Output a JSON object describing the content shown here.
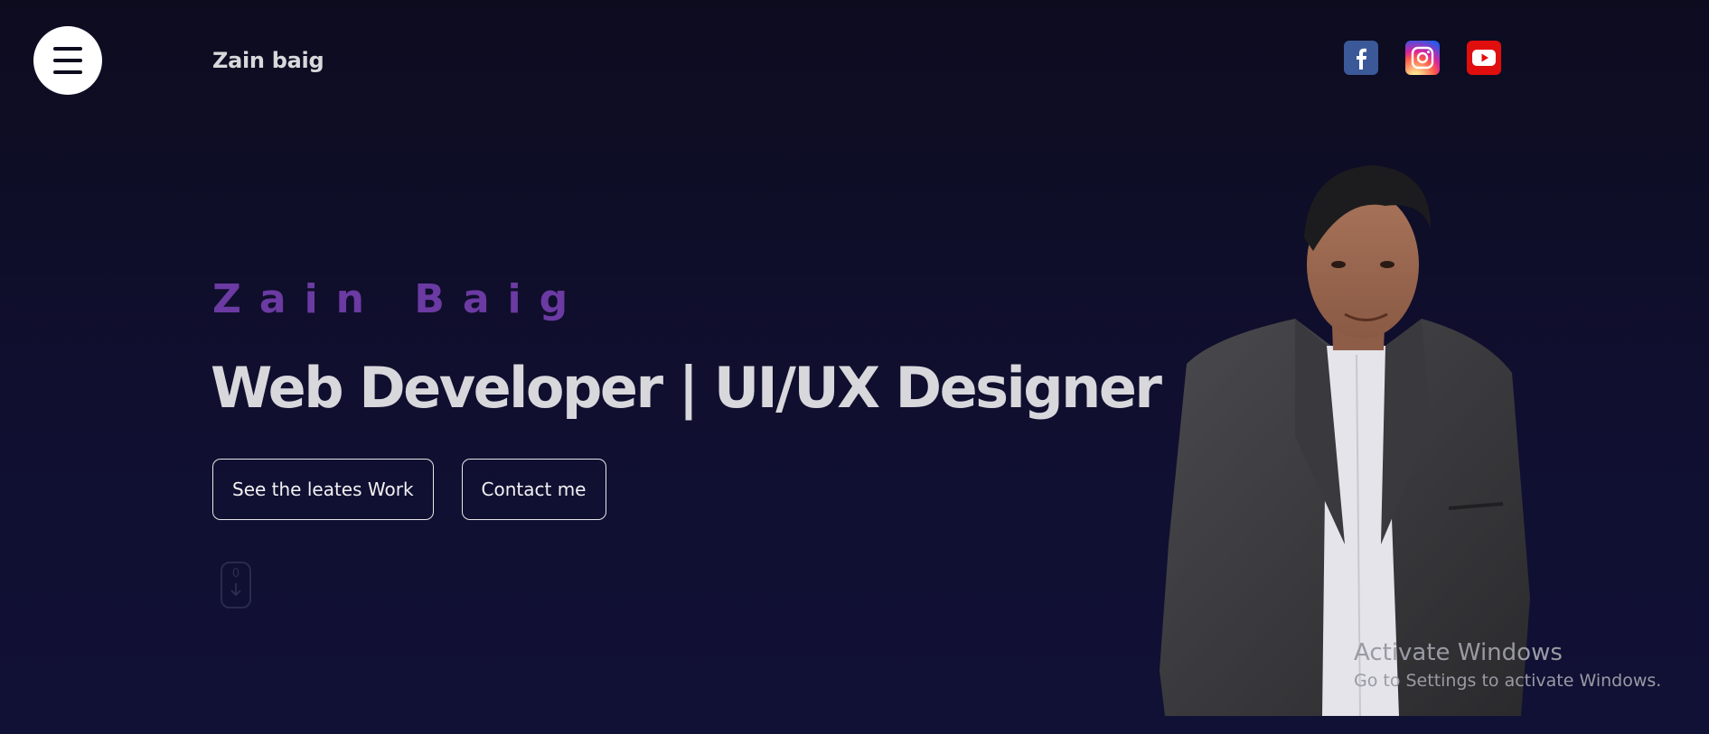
{
  "header": {
    "menu_icon": "hamburger-menu-icon",
    "brand": "Zain baig",
    "socials": [
      {
        "name": "facebook",
        "icon": "facebook-icon",
        "color": "#3b5998"
      },
      {
        "name": "instagram",
        "icon": "instagram-icon",
        "color": "#d6249f"
      },
      {
        "name": "youtube",
        "icon": "youtube-icon",
        "color": "#e10e0e"
      }
    ]
  },
  "hero": {
    "name": "Zain Baig",
    "title": "Web Developer | UI/UX Designer",
    "primary_button": "See the leates Work",
    "secondary_button": "Contact me",
    "scroll_indicator_glyph": "0",
    "scroll_icon": "scroll-down-mouse-icon",
    "portrait_icon": "profile-portrait-image"
  },
  "os_watermark": {
    "title": "Activate Windows",
    "subtitle": "Go to Settings to activate Windows."
  },
  "colors": {
    "background": "#0d0c1f",
    "accent_name": "#6b3aa2",
    "text": "#d8d8dc"
  }
}
